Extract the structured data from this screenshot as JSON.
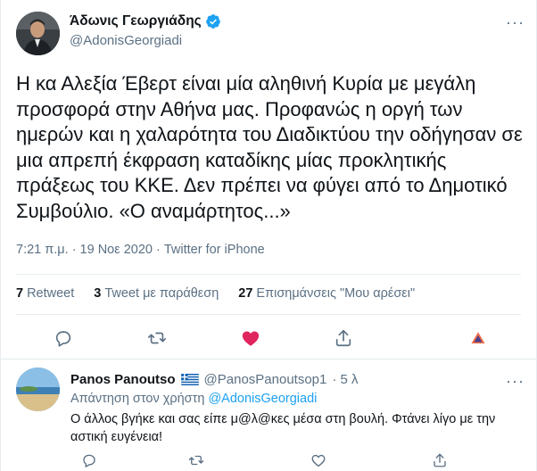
{
  "tweet": {
    "author_name": "Άδωνις Γεωργιάδης",
    "author_handle": "@AdonisGeorgiadi",
    "text": "Η κα Αλεξία Έβερτ είναι μία αληθινή Κυρία με μεγάλη προσφορά στην Αθήνα μας. Προφανώς η οργή των ημερών και η χαλαρότητα του Διαδικτύου την οδήγησαν σε μια απρεπή έκφραση καταδίκης μίας προκλητικής πράξεως του ΚΚΕ. Δεν πρέπει να φύγει από το Δημοτικό Συμβούλιο. «Ο αναμάρτητος...»",
    "meta": "7:21 π.μ. · 19 Νοε 2020 · Twitter for iPhone",
    "more": "···",
    "stats": {
      "retweets_count": "7",
      "retweets_label": "Retweet",
      "quotes_count": "3",
      "quotes_label": "Tweet με παράθεση",
      "likes_count": "27",
      "likes_label": "Επισημάνσεις \"Μου αρέσει\""
    },
    "actions": [
      "reply-icon",
      "retweet-icon",
      "like-icon-filled",
      "share-icon",
      "analytics-icon"
    ],
    "like_color": "#e0245e"
  },
  "reply": {
    "author_name": "Panos Panoutso",
    "author_handle": "@PanosPanoutsop1",
    "time": "· 5 λ",
    "more": "···",
    "replying_prefix": "Απάντηση στον χρήστη",
    "replying_to": "@AdonisGeorgiadi",
    "text": "Ο άλλος βγήκε και σας είπε μ@λ@κες μέσα στη βουλή. Φτάνει λίγο με την αστική ευγένεια!",
    "actions": [
      "reply-icon",
      "retweet-icon",
      "like-icon",
      "share-icon"
    ]
  },
  "colors": {
    "accent": "#1da1f2",
    "secondary_text": "#5b7083",
    "divider": "#e6ecf0"
  }
}
